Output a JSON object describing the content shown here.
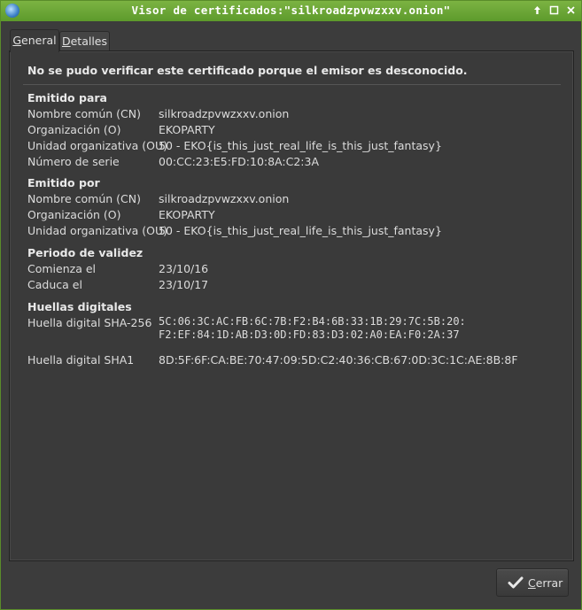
{
  "window": {
    "title": "Visor de certificados:\"silkroadzpvwzxxv.onion\"",
    "icon": "globe-icon"
  },
  "tabs": [
    {
      "label_first": "G",
      "label_rest": "eneral",
      "selected": true
    },
    {
      "label_first": "D",
      "label_rest": "etalles",
      "selected": false
    }
  ],
  "warning": "No se pudo verificar este certificado porque el emisor es desconocido.",
  "issued_to": {
    "title": "Emitido para",
    "rows": [
      {
        "label": "Nombre común (CN)",
        "value": "silkroadzpvwzxxv.onion"
      },
      {
        "label": "Organización (O)",
        "value": "EKOPARTY"
      },
      {
        "label": "Unidad organizativa (OU)",
        "value": "50 - EKO{is_this_just_real_life_is_this_just_fantasy}"
      },
      {
        "label": "Número de serie",
        "value": "00:CC:23:E5:FD:10:8A:C2:3A"
      }
    ]
  },
  "issued_by": {
    "title": "Emitido por",
    "rows": [
      {
        "label": "Nombre común (CN)",
        "value": "silkroadzpvwzxxv.onion"
      },
      {
        "label": "Organización (O)",
        "value": "EKOPARTY"
      },
      {
        "label": "Unidad organizativa (OU)",
        "value": "50 - EKO{is_this_just_real_life_is_this_just_fantasy}"
      }
    ]
  },
  "validity": {
    "title": "Periodo de validez",
    "rows": [
      {
        "label": "Comienza el",
        "value": "23/10/16"
      },
      {
        "label": "Caduca el",
        "value": "23/10/17"
      }
    ]
  },
  "fingerprints": {
    "title": "Huellas digitales",
    "sha256_label": "Huella digital SHA-256",
    "sha256_line1": "5C:06:3C:AC:FB:6C:7B:F2:B4:6B:33:1B:29:7C:5B:20:",
    "sha256_line2": "F2:EF:84:1D:AB:D3:0D:FD:83:D3:02:A0:EA:F0:2A:37",
    "sha1_label": "Huella digital SHA1",
    "sha1_value": "8D:5F:6F:CA:BE:70:47:09:5D:C2:40:36:CB:67:0D:3C:1C:AE:8B:8F"
  },
  "close_button": {
    "label_first": "C",
    "label_rest": "errar"
  }
}
